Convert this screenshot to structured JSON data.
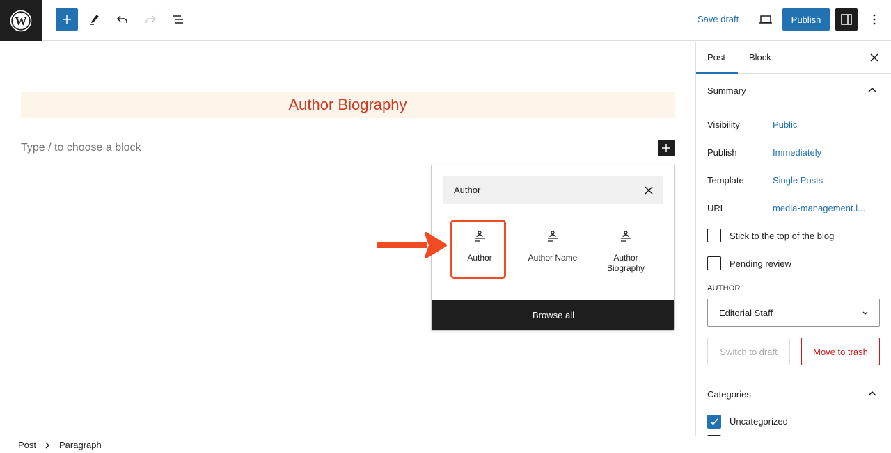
{
  "toolbar": {
    "logo": "wordpress-logo",
    "inserter_icon": "plus-icon",
    "tools_icon": "pencil-icon",
    "undo_icon": "undo-icon",
    "redo_icon": "redo-icon",
    "list_view_icon": "list-view-icon",
    "save_draft_label": "Save draft",
    "preview_icon": "laptop-icon",
    "publish_label": "Publish",
    "settings_icon": "sidebar-icon",
    "options_icon": "more-vertical-icon"
  },
  "editor": {
    "title": "Author Biography",
    "placeholder": "Type / to choose a block",
    "colors": {
      "title_bg": "#fdf4ea",
      "title_text": "#cf3a24"
    }
  },
  "inserter": {
    "search_value": "Author",
    "results": [
      {
        "label": "Author",
        "icon": "author-icon",
        "highlighted": true
      },
      {
        "label": "Author Name",
        "icon": "author-icon",
        "highlighted": false
      },
      {
        "label": "Author\nBiography",
        "icon": "author-icon",
        "highlighted": false
      }
    ],
    "browse_all_label": "Browse all",
    "highlight_color": "#f04b23"
  },
  "sidebar": {
    "tabs": [
      {
        "label": "Post",
        "active": true
      },
      {
        "label": "Block",
        "active": false
      }
    ],
    "summary": {
      "title": "Summary",
      "rows": [
        {
          "label": "Visibility",
          "value": "Public"
        },
        {
          "label": "Publish",
          "value": "Immediately"
        },
        {
          "label": "Template",
          "value": "Single Posts"
        },
        {
          "label": "URL",
          "value": "media-management.l..."
        }
      ],
      "checkboxes": [
        {
          "label": "Stick to the top of the blog",
          "checked": false
        },
        {
          "label": "Pending review",
          "checked": false
        }
      ],
      "author_label": "AUTHOR",
      "author_value": "Editorial Staff",
      "switch_to_draft_label": "Switch to draft",
      "move_to_trash_label": "Move to trash"
    },
    "categories": {
      "title": "Categories",
      "items": [
        {
          "label": "Uncategorized",
          "checked": true
        }
      ]
    }
  },
  "breadcrumb": {
    "items": [
      "Post",
      "Paragraph"
    ]
  },
  "accent_color": "#2271b1"
}
